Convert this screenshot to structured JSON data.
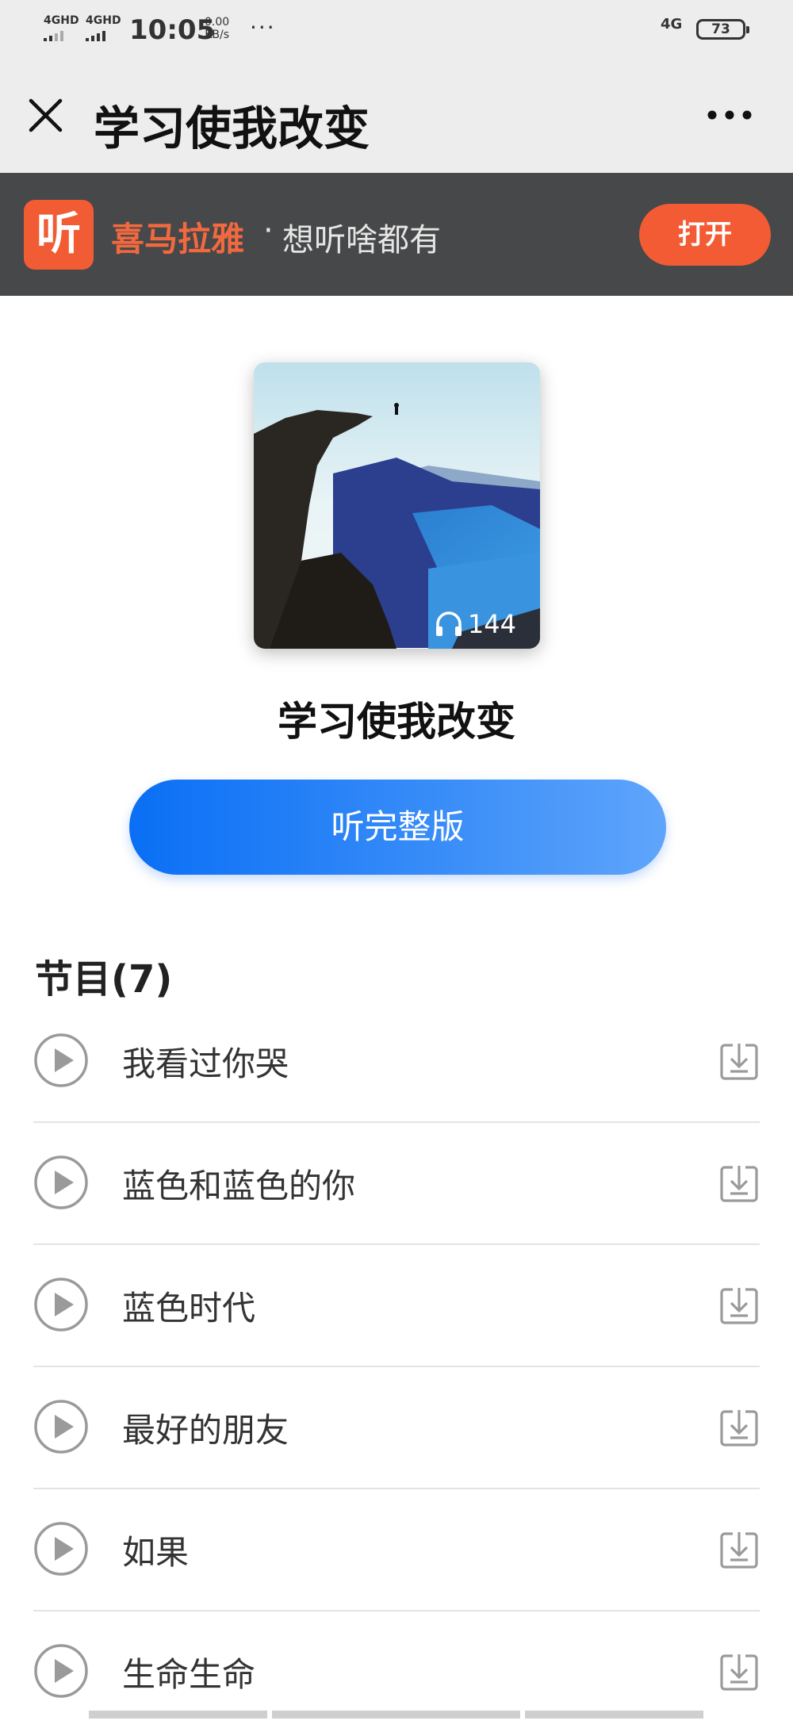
{
  "status_bar": {
    "signal1": "4GHD",
    "signal2": "4GHD",
    "time": "10:05",
    "speed_value": "0.00",
    "speed_unit": "KB/s",
    "more": "···",
    "network": "4G",
    "battery": "73"
  },
  "nav": {
    "title": "学习使我改变"
  },
  "banner": {
    "logo_text": "听",
    "brand": "喜马拉雅",
    "dot": "·",
    "slogan": "想听啥都有",
    "open_label": "打开",
    "brand_color": "#f25c34"
  },
  "album": {
    "play_count": "144",
    "title": "学习使我改变",
    "listen_full_label": "听完整版"
  },
  "tracks_section": {
    "title": "节目(7)",
    "items": [
      {
        "name": "我看过你哭"
      },
      {
        "name": "蓝色和蓝色的你"
      },
      {
        "name": "蓝色时代"
      },
      {
        "name": "最好的朋友"
      },
      {
        "name": "如果"
      },
      {
        "name": "生命生命"
      }
    ]
  },
  "colors": {
    "accent_blue": "#0a6ff5",
    "banner_bg": "#474849",
    "open_button": "#f35b34"
  }
}
